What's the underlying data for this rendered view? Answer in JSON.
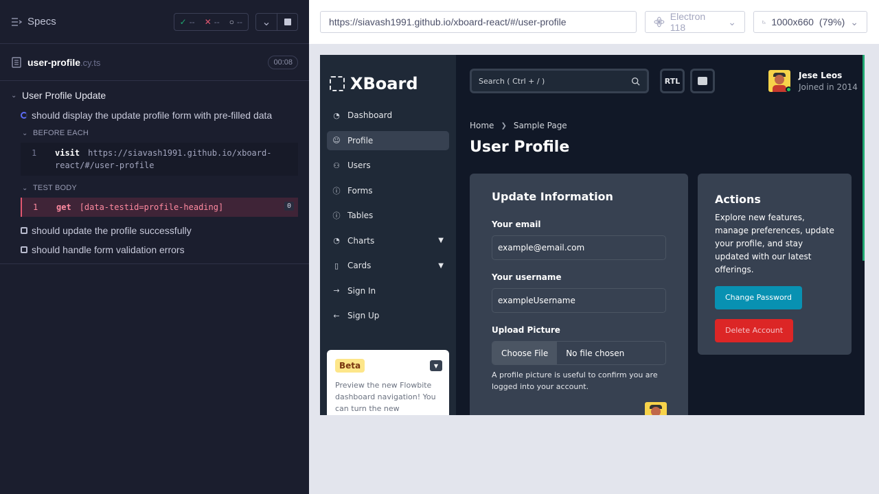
{
  "reporter": {
    "title": "Specs",
    "stats": {
      "passed": "--",
      "failed": "--",
      "pending": "--"
    },
    "spec": {
      "name": "user-profile",
      "ext": ".cy.ts",
      "duration": "00:08"
    },
    "suite": "User Profile Update",
    "tests": [
      {
        "title": "should display the update profile form with pre-filled data",
        "state": "running"
      },
      {
        "title": "should update the profile successfully",
        "state": "pending"
      },
      {
        "title": "should handle form validation errors",
        "state": "pending"
      }
    ],
    "before_each": {
      "label": "BEFORE EACH",
      "cmd": {
        "num": "1",
        "name": "visit",
        "arg_line1": "https://siavash1991.github.io/xboard-",
        "arg_line2": "react/#/user-profile"
      }
    },
    "test_body": {
      "label": "TEST BODY",
      "cmd": {
        "num": "1",
        "name": "get",
        "arg": "[data-testid=profile-heading]",
        "count": "0"
      }
    }
  },
  "aut": {
    "url": "https://siavash1991.github.io/xboard-react/#/user-profile",
    "browser": "Electron 118",
    "viewport": "1000x660",
    "scale": "(79%)"
  },
  "app": {
    "logo": "XBoard",
    "nav": [
      {
        "label": "Dashboard",
        "icon": "◔",
        "active": false,
        "chevron": false
      },
      {
        "label": "Profile",
        "icon": "☺",
        "active": true,
        "chevron": false
      },
      {
        "label": "Users",
        "icon": "⚇",
        "active": false,
        "chevron": false
      },
      {
        "label": "Forms",
        "icon": "ⓘ",
        "active": false,
        "chevron": false
      },
      {
        "label": "Tables",
        "icon": "ⓘ",
        "active": false,
        "chevron": false
      },
      {
        "label": "Charts",
        "icon": "◔",
        "active": false,
        "chevron": true
      },
      {
        "label": "Cards",
        "icon": "▯",
        "active": false,
        "chevron": true
      },
      {
        "label": "Sign In",
        "icon": "→",
        "active": false,
        "chevron": false
      },
      {
        "label": "Sign Up",
        "icon": "←",
        "active": false,
        "chevron": false
      }
    ],
    "beta": {
      "badge": "Beta",
      "text": "Preview the new Flowbite dashboard navigation! You can turn the new navigation"
    },
    "search_placeholder": "Search ( Ctrl + / )",
    "rtl_label": "RTL",
    "user": {
      "name": "Jese Leos",
      "subtitle": "Joined in 2014"
    },
    "breadcrumb": {
      "home": "Home",
      "current": "Sample Page"
    },
    "page_title": "User Profile",
    "update_card": {
      "title": "Update Information",
      "email_label": "Your email",
      "email_value": "example@email.com",
      "username_label": "Your username",
      "username_value": "exampleUsername",
      "upload_label": "Upload Picture",
      "choose_file": "Choose File",
      "no_file": "No file chosen",
      "help": "A profile picture is useful to confirm you are logged into your account."
    },
    "actions_card": {
      "title": "Actions",
      "text": "Explore new features, manage preferences, update your profile, and stay updated with our latest offerings.",
      "change_password": "Change Password",
      "delete_account": "Delete Account"
    }
  },
  "colors": {
    "reporter_bg": "#1b1e2e",
    "pass": "#1fa971",
    "fail": "#e45770",
    "running": "#5d6cf6",
    "app_bg": "#111827",
    "sidebar_bg": "#1f2937",
    "card_bg": "#374151",
    "cyan_button": "#0891b2",
    "red_button": "#dc2626"
  }
}
